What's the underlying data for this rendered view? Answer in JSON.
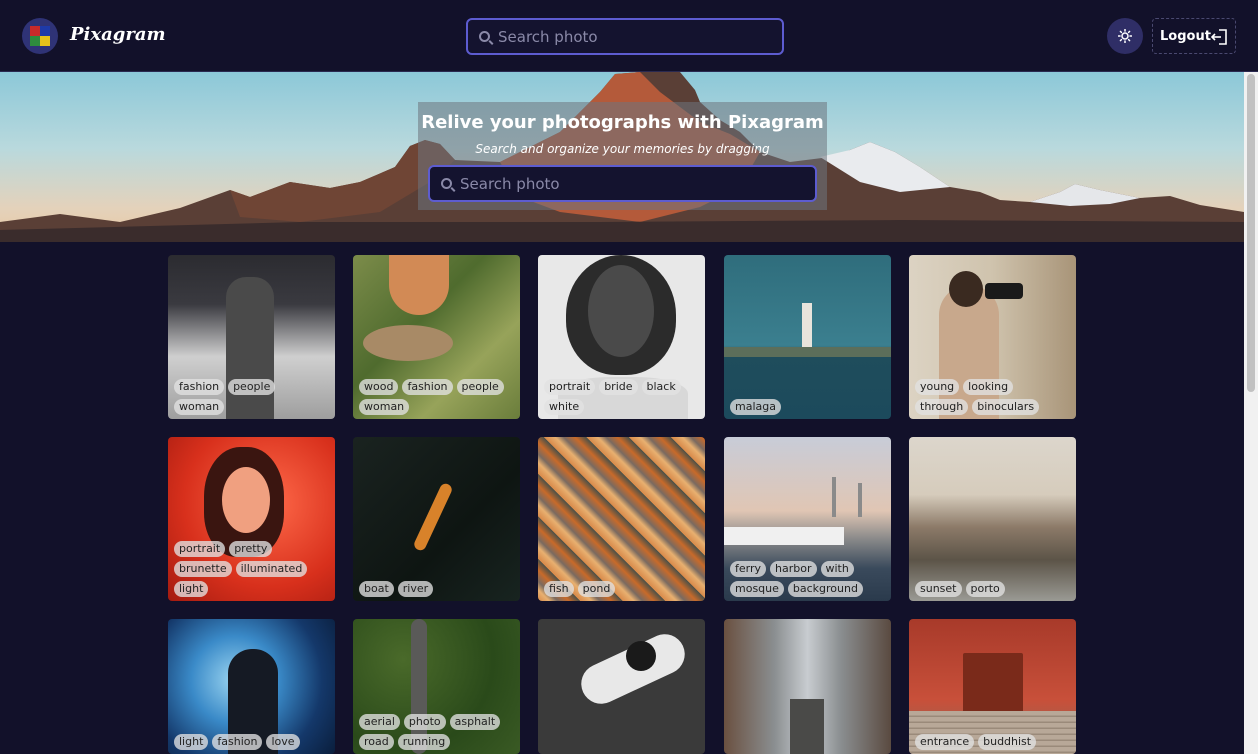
{
  "header": {
    "brand": "Pixagram",
    "search_placeholder": "Search photo",
    "logout_label": "Logout"
  },
  "hero": {
    "title": "Relive your photographs with Pixagram",
    "subtitle": "Search and organize your memories by dragging",
    "search_placeholder": "Search photo"
  },
  "colors": {
    "background": "#12112a",
    "accent": "#5d5cd0",
    "theme_button": "#2f2e66"
  },
  "photos": [
    {
      "tags": [
        "fashion",
        "people",
        "woman"
      ]
    },
    {
      "tags": [
        "wood",
        "fashion",
        "people",
        "woman"
      ]
    },
    {
      "tags": [
        "portrait",
        "bride",
        "black",
        "white"
      ]
    },
    {
      "tags": [
        "malaga"
      ]
    },
    {
      "tags": [
        "young",
        "looking",
        "through",
        "binoculars"
      ]
    },
    {
      "tags": [
        "portrait",
        "pretty",
        "brunette",
        "illuminated",
        "light"
      ]
    },
    {
      "tags": [
        "boat",
        "river"
      ]
    },
    {
      "tags": [
        "fish",
        "pond"
      ]
    },
    {
      "tags": [
        "ferry",
        "harbor",
        "with",
        "mosque",
        "background"
      ]
    },
    {
      "tags": [
        "sunset",
        "porto"
      ]
    },
    {
      "tags": [
        "light",
        "fashion",
        "love"
      ]
    },
    {
      "tags": [
        "aerial",
        "photo",
        "asphalt",
        "road",
        "running"
      ]
    },
    {
      "tags": []
    },
    {
      "tags": []
    },
    {
      "tags": [
        "entrance",
        "buddhist"
      ]
    }
  ]
}
